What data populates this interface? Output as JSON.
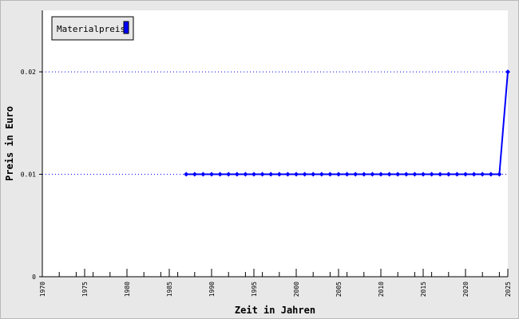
{
  "chart_data": {
    "type": "line",
    "title": "",
    "xlabel": "Zeit in Jahren",
    "ylabel": "Preis in Euro",
    "xlim": [
      1970,
      2025
    ],
    "ylim": [
      0,
      0.026
    ],
    "x_ticks": [
      "1970",
      "1975",
      "1980",
      "1985",
      "1990",
      "1995",
      "2000",
      "2005",
      "2010",
      "2015",
      "2020",
      "2025"
    ],
    "y_ticks": [
      "0",
      "0.01",
      "0.02"
    ],
    "grid": "horizontal dotted at 0.01 and 0.02",
    "legend": "top-left",
    "series": [
      {
        "name": "Materialpreis",
        "color": "#0000ff",
        "x": [
          1987,
          1988,
          1989,
          1990,
          1991,
          1992,
          1993,
          1994,
          1995,
          1996,
          1997,
          1998,
          1999,
          2000,
          2001,
          2002,
          2003,
          2004,
          2005,
          2006,
          2007,
          2008,
          2009,
          2010,
          2011,
          2012,
          2013,
          2014,
          2015,
          2016,
          2017,
          2018,
          2019,
          2020,
          2021,
          2022,
          2023,
          2024,
          2025
        ],
        "values": [
          0.01,
          0.01,
          0.01,
          0.01,
          0.01,
          0.01,
          0.01,
          0.01,
          0.01,
          0.01,
          0.01,
          0.01,
          0.01,
          0.01,
          0.01,
          0.01,
          0.01,
          0.01,
          0.01,
          0.01,
          0.01,
          0.01,
          0.01,
          0.01,
          0.01,
          0.01,
          0.01,
          0.01,
          0.01,
          0.01,
          0.01,
          0.01,
          0.01,
          0.01,
          0.01,
          0.01,
          0.01,
          0.01,
          0.02
        ]
      }
    ]
  }
}
